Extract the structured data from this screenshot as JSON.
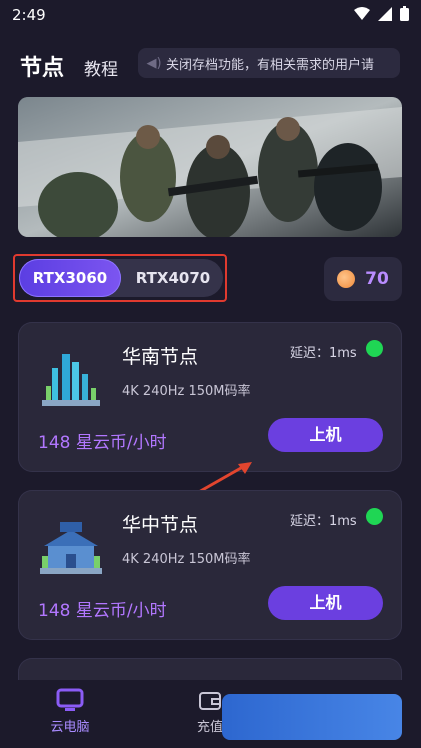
{
  "status": {
    "time": "2:49"
  },
  "header": {
    "title": "节点",
    "tutorial": "教程",
    "notice": "关闭存档功能，有相关需求的用户请"
  },
  "gpu": {
    "selected": "RTX3060",
    "other": "RTX4070"
  },
  "coins": {
    "value": "70"
  },
  "nodes": [
    {
      "name": "华南节点",
      "spec": "4K 240Hz 150M码率",
      "latency": "延迟：1ms",
      "price": "148 星云币/小时",
      "button": "上机"
    },
    {
      "name": "华中节点",
      "spec": "4K 240Hz 150M码率",
      "latency": "延迟：1ms",
      "price": "148 星云币/小时",
      "button": "上机"
    }
  ],
  "nav": {
    "cloud_pc": "云电脑",
    "recharge": "充值"
  },
  "colors": {
    "accent": "#6b3fe0",
    "online": "#1fd654",
    "price": "#b277ff"
  }
}
